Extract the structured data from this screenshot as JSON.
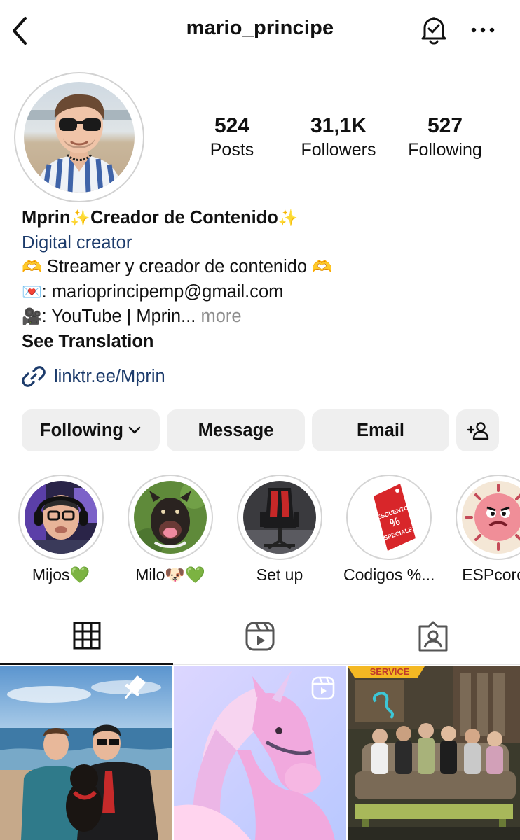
{
  "header": {
    "username": "mario_principe"
  },
  "stats": {
    "posts": {
      "value": "524",
      "label": "Posts"
    },
    "followers": {
      "value": "31,1K",
      "label": "Followers"
    },
    "following": {
      "value": "527",
      "label": "Following"
    }
  },
  "bio": {
    "name": "Mprin",
    "name_suffix": "Creador de Contenido",
    "category": "Digital creator",
    "line1": "Streamer y creador de contenido",
    "line2": ": marioprincipemp@gmail.com",
    "line3": ": YouTube | Mprin...",
    "more": "more",
    "see_translation": "See Translation"
  },
  "link": {
    "text": "linktr.ee/Mprin"
  },
  "buttons": {
    "following": "Following",
    "message": "Message",
    "email": "Email"
  },
  "highlights": [
    {
      "label": "Mijos💚"
    },
    {
      "label": "Milo🐶💚"
    },
    {
      "label": "Set up"
    },
    {
      "label": "Codigos %..."
    },
    {
      "label": "ESPcoron"
    }
  ],
  "highlight_art": {
    "codigos_line1": "DESCUENTOS",
    "codigos_pct": "%",
    "codigos_line2": "ESPECIALES"
  },
  "grid_art": {
    "post3_sign": "SERVICE"
  },
  "icons": {
    "back": "chevron-left-icon",
    "bell": "notification-bell-check-icon",
    "more": "more-horizontal-icon",
    "link": "link-icon",
    "add_user": "add-user-icon",
    "grid": "grid-icon",
    "reels": "reels-icon",
    "tagged": "tagged-icon",
    "pin": "pin-icon"
  },
  "colors": {
    "link_blue": "#1c3b6b",
    "button_bg": "#efefef",
    "muted": "#8e8e8e"
  }
}
